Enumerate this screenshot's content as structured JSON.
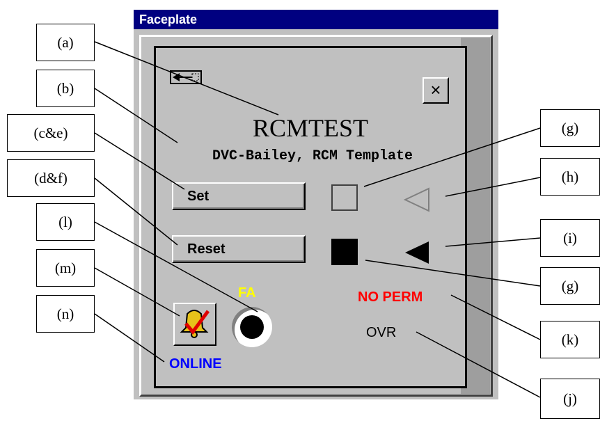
{
  "window": {
    "title": "Faceplate"
  },
  "faceplate": {
    "tag": "RCMTEST",
    "description": "DVC-Bailey, RCM Template",
    "close_label": "×",
    "set_label": "Set",
    "reset_label": "Reset",
    "fa_label": "FA",
    "no_perm_label": "NO PERM",
    "ovr_label": "OVR",
    "online_label": "ONLINE"
  },
  "callouts": {
    "a": "(a)",
    "b": "(b)",
    "ce": "(c&e)",
    "df": "(d&f)",
    "l": "(l)",
    "m": "(m)",
    "n": "(n)",
    "g1": "(g)",
    "h": "(h)",
    "i": "(i)",
    "g2": "(g)",
    "k": "(k)",
    "j": "(j)"
  },
  "colors": {
    "titlebar": "#000080",
    "no_perm": "#ff0000",
    "online": "#0000ff",
    "fa": "#ffff00"
  }
}
